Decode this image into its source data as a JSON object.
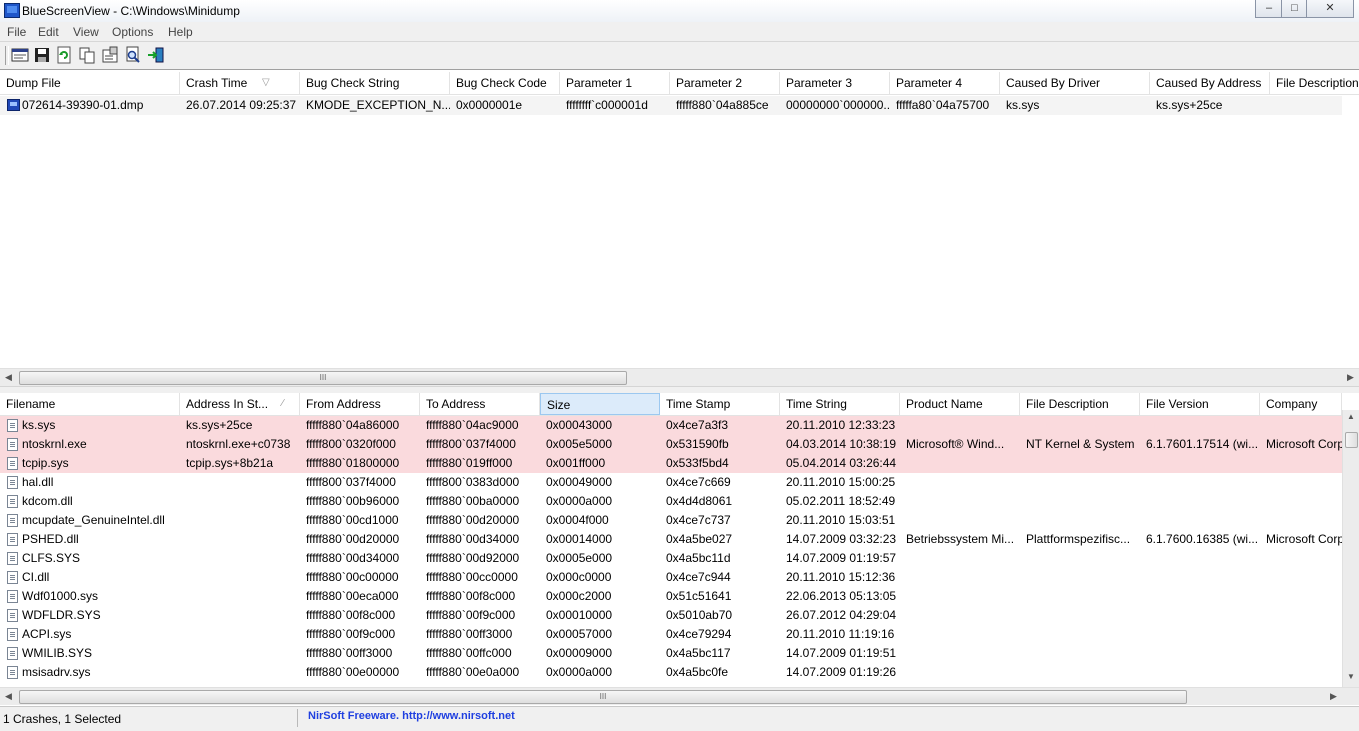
{
  "window": {
    "title": "BlueScreenView  -  C:\\Windows\\Minidump",
    "minimize": "–",
    "maximize": "□",
    "close": "✕"
  },
  "menu": [
    "File",
    "Edit",
    "View",
    "Options",
    "Help"
  ],
  "toolbar": {
    "buttons": [
      "html-report-icon",
      "save-icon",
      "refresh-icon",
      "copy-icon",
      "properties-icon",
      "find-icon",
      "exit-icon"
    ]
  },
  "crash_list": {
    "columns": [
      "Dump File",
      "Crash Time",
      "Bug Check String",
      "Bug Check Code",
      "Parameter 1",
      "Parameter 2",
      "Parameter 3",
      "Parameter 4",
      "Caused By Driver",
      "Caused By Address",
      "File Description"
    ],
    "sort_indicator": "▽",
    "rows": [
      [
        "072614-39390-01.dmp",
        "26.07.2014 09:25:37",
        "KMODE_EXCEPTION_N...",
        "0x0000001e",
        "ffffffff`c000001d",
        "fffff880`04a885ce",
        "00000000`000000...",
        "fffffa80`04a75700",
        "ks.sys",
        "ks.sys+25ce",
        ""
      ]
    ]
  },
  "driver_list": {
    "columns": [
      "Filename",
      "Address In St...",
      "From Address",
      "To Address",
      "Size",
      "Time Stamp",
      "Time String",
      "Product Name",
      "File Description",
      "File Version",
      "Company"
    ],
    "sort_indicator": "∕",
    "rows": [
      [
        "ks.sys",
        "ks.sys+25ce",
        "fffff880`04a86000",
        "fffff880`04ac9000",
        "0x00043000",
        "0x4ce7a3f3",
        "20.11.2010 12:33:23",
        "",
        "",
        "",
        ""
      ],
      [
        "ntoskrnl.exe",
        "ntoskrnl.exe+c0738",
        "fffff800`0320f000",
        "fffff800`037f4000",
        "0x005e5000",
        "0x531590fb",
        "04.03.2014 10:38:19",
        "Microsoft® Wind...",
        "NT Kernel & System",
        "6.1.7601.17514 (wi...",
        "Microsoft Corp"
      ],
      [
        "tcpip.sys",
        "tcpip.sys+8b21a",
        "fffff880`01800000",
        "fffff880`019ff000",
        "0x001ff000",
        "0x533f5bd4",
        "05.04.2014 03:26:44",
        "",
        "",
        "",
        ""
      ],
      [
        "hal.dll",
        "",
        "fffff800`037f4000",
        "fffff800`0383d000",
        "0x00049000",
        "0x4ce7c669",
        "20.11.2010 15:00:25",
        "",
        "",
        "",
        ""
      ],
      [
        "kdcom.dll",
        "",
        "fffff880`00b96000",
        "fffff880`00ba0000",
        "0x0000a000",
        "0x4d4d8061",
        "05.02.2011 18:52:49",
        "",
        "",
        "",
        ""
      ],
      [
        "mcupdate_GenuineIntel.dll",
        "",
        "fffff880`00cd1000",
        "fffff880`00d20000",
        "0x0004f000",
        "0x4ce7c737",
        "20.11.2010 15:03:51",
        "",
        "",
        "",
        ""
      ],
      [
        "PSHED.dll",
        "",
        "fffff880`00d20000",
        "fffff880`00d34000",
        "0x00014000",
        "0x4a5be027",
        "14.07.2009 03:32:23",
        "Betriebssystem Mi...",
        "Plattformspezifisc...",
        "6.1.7600.16385 (wi...",
        "Microsoft Corp"
      ],
      [
        "CLFS.SYS",
        "",
        "fffff880`00d34000",
        "fffff880`00d92000",
        "0x0005e000",
        "0x4a5bc11d",
        "14.07.2009 01:19:57",
        "",
        "",
        "",
        ""
      ],
      [
        "CI.dll",
        "",
        "fffff880`00c00000",
        "fffff880`00cc0000",
        "0x000c0000",
        "0x4ce7c944",
        "20.11.2010 15:12:36",
        "",
        "",
        "",
        ""
      ],
      [
        "Wdf01000.sys",
        "",
        "fffff880`00eca000",
        "fffff880`00f8c000",
        "0x000c2000",
        "0x51c51641",
        "22.06.2013 05:13:05",
        "",
        "",
        "",
        ""
      ],
      [
        "WDFLDR.SYS",
        "",
        "fffff880`00f8c000",
        "fffff880`00f9c000",
        "0x00010000",
        "0x5010ab70",
        "26.07.2012 04:29:04",
        "",
        "",
        "",
        ""
      ],
      [
        "ACPI.sys",
        "",
        "fffff880`00f9c000",
        "fffff880`00ff3000",
        "0x00057000",
        "0x4ce79294",
        "20.11.2010 11:19:16",
        "",
        "",
        "",
        ""
      ],
      [
        "WMILIB.SYS",
        "",
        "fffff880`00ff3000",
        "fffff880`00ffc000",
        "0x00009000",
        "0x4a5bc117",
        "14.07.2009 01:19:51",
        "",
        "",
        "",
        ""
      ],
      [
        "msisadrv.sys",
        "",
        "fffff880`00e00000",
        "fffff880`00e0a000",
        "0x0000a000",
        "0x4a5bc0fe",
        "14.07.2009 01:19:26",
        "",
        "",
        "",
        ""
      ]
    ],
    "highlighted_rows": [
      0,
      1,
      2
    ]
  },
  "scroll_grip": "III",
  "status": {
    "count": "1 Crashes, 1 Selected",
    "link": "NirSoft Freeware.  http://www.nirsoft.net"
  },
  "colors": {
    "highlight_row": "#fadadd",
    "link": "#1f3fe0",
    "sorted_header": "#dcebfa"
  }
}
